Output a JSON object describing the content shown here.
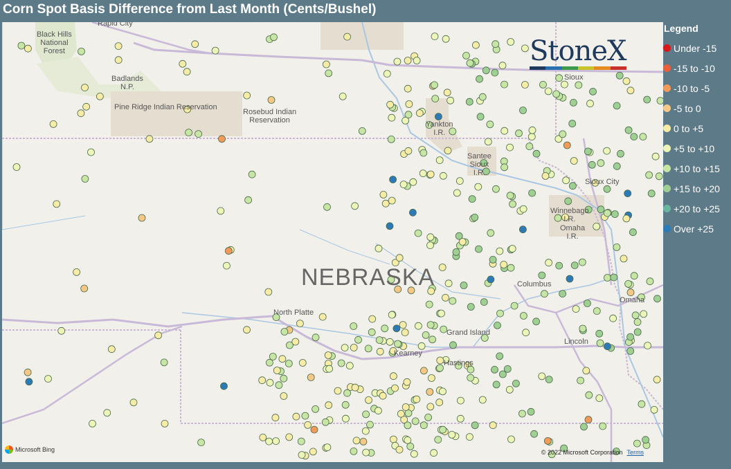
{
  "title": "Corn Spot Basis Difference from Last Month (Cents/Bushel)",
  "map": {
    "state_label": "NEBRASKA",
    "places": [
      {
        "name": "Black Hills\nNational\nForest"
      },
      {
        "name": "Badlands\nN.P."
      },
      {
        "name": "Pine Ridge Indian Reservation"
      },
      {
        "name": "Rosebud Indian\nReservation"
      },
      {
        "name": "Rapid City"
      },
      {
        "name": "Yankton\nI.R."
      },
      {
        "name": "Santee\nSioux\nI.R."
      },
      {
        "name": "Sioux City"
      },
      {
        "name": "Sioux"
      },
      {
        "name": "Winnebago\nI.R."
      },
      {
        "name": "Omaha\nI.R."
      },
      {
        "name": "Omaha"
      },
      {
        "name": "Columbus"
      },
      {
        "name": "North Platte"
      },
      {
        "name": "Grand Island"
      },
      {
        "name": "Kearney"
      },
      {
        "name": "Hastings"
      },
      {
        "name": "Lincoln"
      }
    ],
    "attribution": "Microsoft Bing",
    "copyright": "© 2022 Microsoft Corporation",
    "terms": "Terms"
  },
  "logo": {
    "text": "StoneX",
    "colors": [
      "#1f3a5c",
      "#2a6fb0",
      "#3d9a4a",
      "#c9c32a",
      "#e58a1f",
      "#c8302c"
    ]
  },
  "legend": {
    "title": "Legend",
    "items": [
      {
        "label": "Under -15",
        "color": "#d7191c"
      },
      {
        "label": "-15 to -10",
        "color": "#e9603a"
      },
      {
        "label": "-10 to -5",
        "color": "#f19a5a"
      },
      {
        "label": "-5 to 0",
        "color": "#f5c887"
      },
      {
        "label": "0 to +5",
        "color": "#f7eba8"
      },
      {
        "label": "+5 to +10",
        "color": "#eef5b8"
      },
      {
        "label": "+10 to +15",
        "color": "#c7e5a4"
      },
      {
        "label": "+15 to +20",
        "color": "#9fcf92"
      },
      {
        "label": "+20 to +25",
        "color": "#6ab5a0"
      },
      {
        "label": "Over +25",
        "color": "#2c7bb6"
      }
    ]
  }
}
